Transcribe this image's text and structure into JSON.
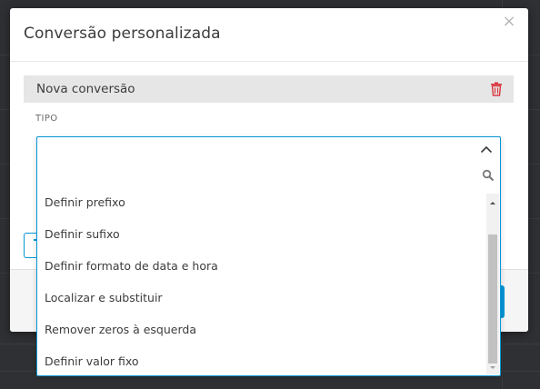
{
  "dialog": {
    "title": "Conversão personalizada",
    "close_icon": "close-icon"
  },
  "conversion": {
    "name": "Nova conversão",
    "delete_icon": "trash-icon",
    "delete_color": "#d9363e"
  },
  "type_field": {
    "label": "TIPO",
    "value": "",
    "search_value": "",
    "accent_color": "#0696d7",
    "options": [
      "Definir prefixo",
      "Definir sufixo",
      "Definir formato de data e hora",
      "Localizar e substituir",
      "Remover zeros à esquerda",
      "Definir valor fixo"
    ]
  }
}
